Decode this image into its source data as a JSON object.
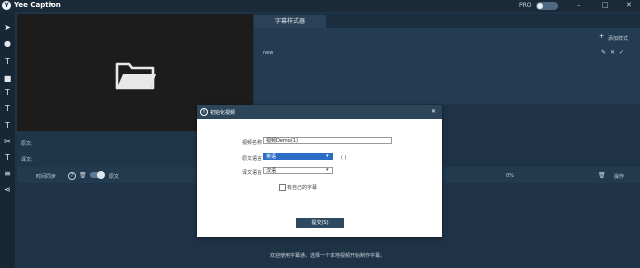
{
  "app": {
    "title": "Yee Caption",
    "pro_label": "PRO",
    "logo_glyph": "Y"
  },
  "window_controls": {
    "minimize": "–",
    "maximize": "□",
    "close": "✕"
  },
  "toolbar_icons": [
    "cursor-icon",
    "mic-icon",
    "text-t-icon",
    "square-icon",
    "text-box-icon",
    "text-t-alt-icon",
    "text-t-box-icon",
    "cut-icon",
    "split-icon",
    "lines-icon",
    "share-icon"
  ],
  "rows": {
    "source_label": "原文:",
    "translation_label": "译文:"
  },
  "controls": {
    "sync_label": "时间同步",
    "source_toggle_label": "原文",
    "progress": "0%",
    "action_label": "操作"
  },
  "right_panel": {
    "tab": "字幕样式器",
    "add_style": "添加样式",
    "style_item": "new"
  },
  "dialog": {
    "title": "初始化视频",
    "fields": [
      {
        "label": "视频名称",
        "value": "视频Demo(1)"
      },
      {
        "label": "原文语言",
        "value": "英语"
      },
      {
        "label": "译文语言",
        "value": "汉语"
      }
    ],
    "source_hint": "( )",
    "checkbox_label": "有自己的字幕",
    "ok_button": "提交(S)"
  },
  "footer_tip": "欢迎使用字幕通，选择一个本地视频开始制作字幕。"
}
